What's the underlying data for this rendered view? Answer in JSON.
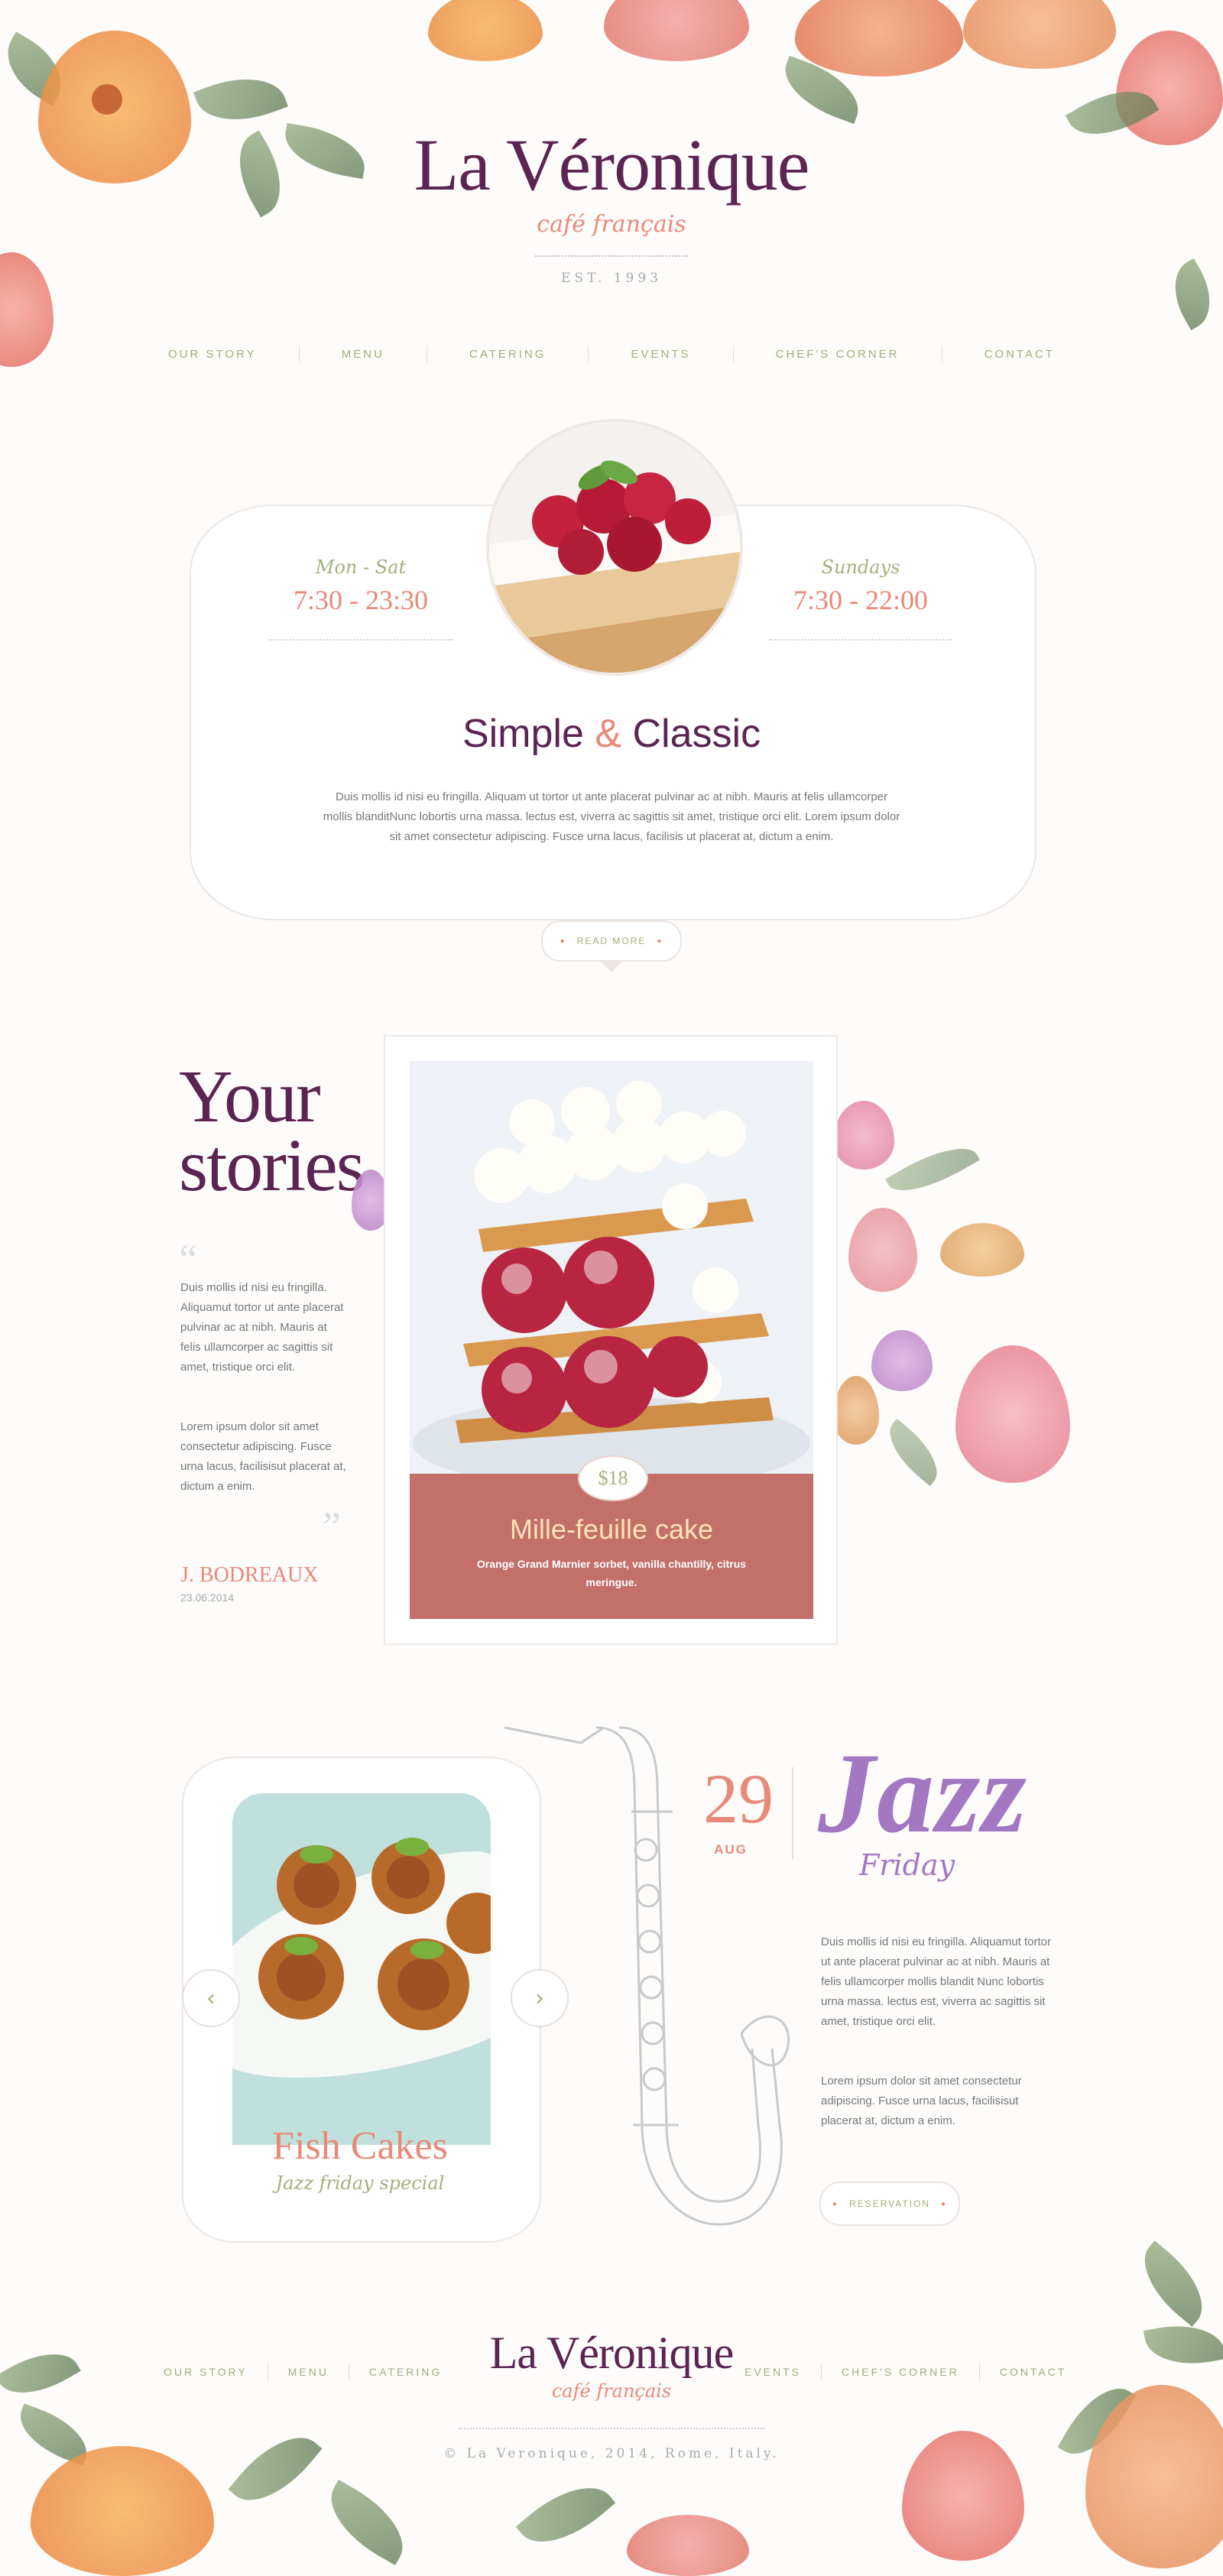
{
  "brand": {
    "name": "La Véronique",
    "tagline": "café français",
    "established": "EST. 1993"
  },
  "nav": {
    "items": [
      "OUR STORY",
      "MENU",
      "CATERING",
      "EVENTS",
      "CHEF'S CORNER",
      "CONTACT"
    ]
  },
  "hours": {
    "weekday_label": "Mon - Sat",
    "weekday_time": "7:30 - 23:30",
    "sunday_label": "Sundays",
    "sunday_time": "7:30 - 22:00"
  },
  "intro": {
    "title_part1": "Simple",
    "title_amp": "&",
    "title_part2": "Classic",
    "text": "Duis mollis id nisi eu fringilla. Aliquam ut tortor ut ante placerat pulvinar ac at nibh. Mauris at felis ullamcorper mollis blanditNunc lobortis urna massa. lectus est, viverra ac sagittis sit amet, tristique orci elit. Lorem ipsum dolor sit amet consectetur adipiscing. Fusce urna lacus, facilisis ut placerat at, dictum a enim.",
    "read_more_label": "READ MORE"
  },
  "stories": {
    "title_line1": "Your",
    "title_line2": "stories",
    "open_quote": "“",
    "close_quote": "”",
    "paragraph1": "Duis mollis id nisi eu fringilla. Aliquamut tortor ut ante placerat pulvinar ac at nibh. Mauris at felis ullamcorper ac sagittis sit amet, tristique orci elit.",
    "paragraph2": "Lorem ipsum dolor sit amet consectetur adipiscing. Fusce urna lacus, facilisisut placerat at, dictum a enim.",
    "author": "J. BODREAUX",
    "date": "23.06.2014"
  },
  "featured": {
    "price": "$18",
    "name": "Mille-feuille cake",
    "description": "Orange Grand Marnier sorbet, vanilla chantilly, citrus meringue."
  },
  "special": {
    "name": "Fish Cakes",
    "subtitle": "Jazz friday special",
    "prev_icon": "‹",
    "next_icon": "›"
  },
  "event": {
    "day": "29",
    "month": "AUG",
    "title": "Jazz",
    "subtitle": "Friday",
    "paragraph1": "Duis mollis id nisi eu fringilla. Aliquamut tortor ut ante placerat pulvinar ac at nibh. Mauris at felis ullamcorper mollis blandit Nunc lobortis urna massa. lectus est, viverra ac sagittis sit amet, tristique orci elit.",
    "paragraph2": "Lorem ipsum dolor sit amet consectetur adipiscing. Fusce urna lacus, facilisisut placerat at, dictum a enim.",
    "reservation_label": "RESERVATION"
  },
  "footer": {
    "nav_left": [
      "OUR STORY",
      "MENU",
      "CATERING"
    ],
    "nav_right": [
      "EVENTS",
      "CHEF'S CORNER",
      "CONTACT"
    ],
    "copyright": "© La Veronique, 2014, Rome, Italy."
  },
  "colors": {
    "brand_plum": "#5c2450",
    "accent_coral": "#e88a77",
    "accent_sage": "#9fae7a",
    "panel_rose": "#c3706a",
    "jazz_violet": "#a377c2"
  }
}
